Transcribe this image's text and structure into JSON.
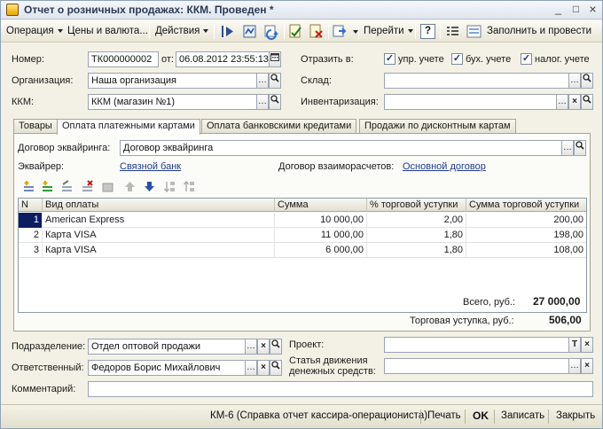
{
  "window": {
    "title": "Отчет о розничных продажах: ККМ. Проведен *",
    "min_label": "_",
    "max_label": "□",
    "close_label": "×"
  },
  "toolbar": {
    "operation": "Операция",
    "prices": "Цены и валюта...",
    "actions": "Действия",
    "goto": "Перейти",
    "help": "?",
    "fill_post": "Заполнить и провести"
  },
  "header": {
    "number_label": "Номер:",
    "number_value": "ТК000000002",
    "from_label": "от:",
    "date_value": "06.08.2012 23:55:13",
    "reflect_label": "Отразить в:",
    "cb_upr": "упр. учете",
    "cb_buh": "бух. учете",
    "cb_nalog": "налог. учете",
    "org_label": "Организация:",
    "org_value": "Наша организация",
    "warehouse_label": "Склад:",
    "warehouse_value": "",
    "kkm_label": "ККМ:",
    "kkm_value": "ККМ (магазин №1)",
    "inventory_label": "Инвентаризация:",
    "inventory_value": ""
  },
  "tabs": [
    {
      "label": "Товары"
    },
    {
      "label": "Оплата платежными картами"
    },
    {
      "label": "Оплата банковскими кредитами"
    },
    {
      "label": "Продажи по дисконтным картам"
    }
  ],
  "panel": {
    "contract_label": "Договор эквайринга:",
    "contract_value": "Договор эквайринга",
    "acquirer_label": "Эквайрер:",
    "acquirer_value": "Связной банк",
    "mutual_label": "Договор взаиморасчетов:",
    "mutual_value": "Основной договор"
  },
  "grid": {
    "columns": [
      "N",
      "Вид оплаты",
      "Сумма",
      "% торговой уступки",
      "Сумма торговой уступки"
    ],
    "rows": [
      {
        "n": "1",
        "type": "American Express",
        "sum": "10 000,00",
        "pct": "2,00",
        "fee": "200,00"
      },
      {
        "n": "2",
        "type": "Карта VISA",
        "sum": "11 000,00",
        "pct": "1,80",
        "fee": "198,00"
      },
      {
        "n": "3",
        "type": "Карта VISA",
        "sum": "6 000,00",
        "pct": "1,80",
        "fee": "108,00"
      }
    ]
  },
  "totals": {
    "total_label": "Всего, руб.:",
    "total_value": "27 000,00",
    "fee_label": "Торговая уступка, руб.:",
    "fee_value": "506,00"
  },
  "footer": {
    "division_label": "Подразделение:",
    "division_value": "Отдел оптовой продажи",
    "project_label": "Проект:",
    "project_value": "",
    "responsible_label": "Ответственный:",
    "responsible_value": "Федоров Борис Михайлович",
    "cashflow_label_1": "Статья движения",
    "cashflow_label_2": "денежных средств:",
    "cashflow_value": "",
    "comment_label": "Комментарий:",
    "comment_value": ""
  },
  "statusbar": {
    "report": "КМ-6 (Справка отчет кассира-операциониста)",
    "print": "Печать",
    "ok": "OK",
    "save": "Записать",
    "close": "Закрыть"
  },
  "colors": {
    "selection": "#0b1d63",
    "link": "#1f3b8c",
    "window_bg": "#f3f1e6"
  }
}
